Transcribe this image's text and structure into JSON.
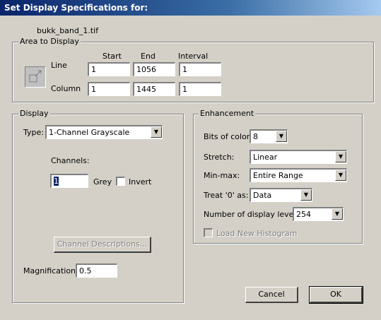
{
  "window": {
    "title": "Set Display Specifications for:"
  },
  "file": {
    "name": "bukk_band_1.tif"
  },
  "area": {
    "legend": "Area to Display",
    "col_start": "Start",
    "col_end": "End",
    "col_interval": "Interval",
    "line_label": "Line",
    "column_label": "Column",
    "line": {
      "start": "1",
      "end": "1056",
      "interval": "1"
    },
    "column": {
      "start": "1",
      "end": "1445",
      "interval": "1"
    },
    "icon": "zoom-area-icon"
  },
  "display": {
    "legend": "Display",
    "type_label": "Type:",
    "type_value": "1-Channel Grayscale",
    "channels_label": "Channels:",
    "channel_value": "1",
    "grey_label": "Grey",
    "invert_label": "Invert",
    "invert_checked": false,
    "channel_desc_button": "Channel Descriptions...",
    "magnification_label": "Magnification:",
    "magnification_value": "0.5"
  },
  "enhancement": {
    "legend": "Enhancement",
    "bits_label": "Bits of color:",
    "bits_value": "8",
    "stretch_label": "Stretch:",
    "stretch_value": "Linear",
    "minmax_label": "Min-max:",
    "minmax_value": "Entire Range",
    "treat0_label": "Treat '0' as:",
    "treat0_value": "Data",
    "levels_label": "Number of display levels:",
    "levels_value": "254",
    "load_histogram_label": "Load New Histogram",
    "load_histogram_checked": false
  },
  "buttons": {
    "cancel": "Cancel",
    "ok": "OK"
  },
  "colors": {
    "face": "#d4d0c8",
    "titlebar": "#0a246a"
  }
}
